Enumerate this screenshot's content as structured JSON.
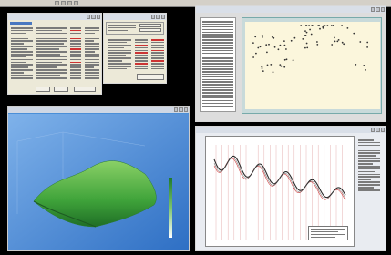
{
  "taskbar": {
    "title": ""
  },
  "windows": {
    "controller": {
      "title": ""
    },
    "settings": {
      "title": ""
    },
    "scatter": {
      "title": ""
    },
    "surface": {
      "title": ""
    },
    "timeseries": {
      "title": ""
    }
  },
  "colors": {
    "desktop": "#000000",
    "plot_bg": "#fbf6dc",
    "surface_green": "#3fa33a",
    "wave_dark": "#2b2b2b",
    "wave_red": "#d04040"
  },
  "icons": [
    "close-icon",
    "minimize-icon",
    "maximize-icon",
    "colorbar-icon"
  ]
}
